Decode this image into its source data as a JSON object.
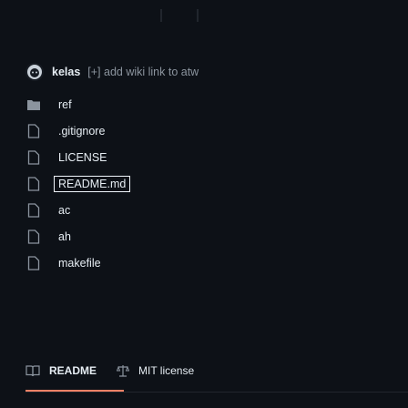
{
  "commit": {
    "author": "kelas",
    "message": "[+] add wiki link to atw"
  },
  "files": [
    {
      "name": "ref",
      "type": "directory",
      "icon": "folder-icon"
    },
    {
      "name": ".gitignore",
      "type": "file",
      "icon": "file-icon"
    },
    {
      "name": "LICENSE",
      "type": "file",
      "icon": "file-icon"
    },
    {
      "name": "README.md",
      "type": "file",
      "icon": "file-icon",
      "selected": true
    },
    {
      "name": "ac",
      "type": "file",
      "icon": "file-icon"
    },
    {
      "name": "ah",
      "type": "file",
      "icon": "file-icon"
    },
    {
      "name": "makefile",
      "type": "file",
      "icon": "file-icon"
    }
  ],
  "tabs": {
    "readme": {
      "label": "README",
      "icon": "book-icon",
      "active": true
    },
    "license": {
      "label": "MIT license",
      "icon": "scale-icon"
    }
  },
  "colors": {
    "background": "#0d1117",
    "text": "#e6edf3",
    "muted": "#8b949e",
    "accent_underline": "#f78166"
  }
}
